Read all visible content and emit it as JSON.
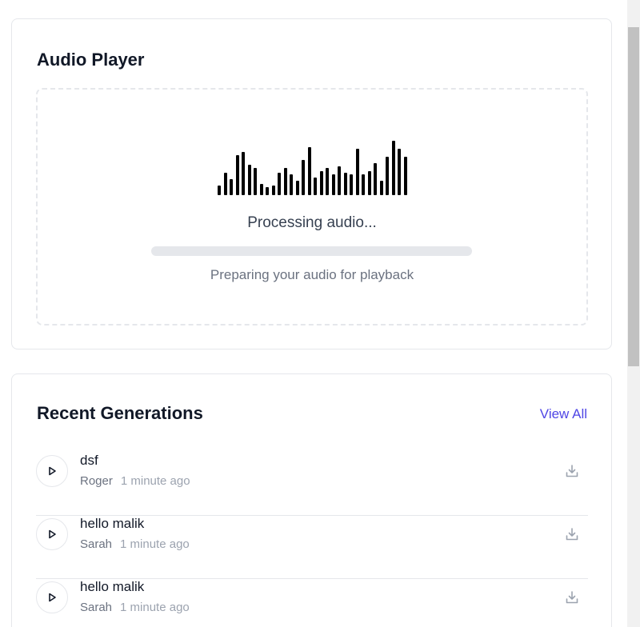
{
  "player": {
    "title": "Audio Player",
    "processing_label": "Processing audio...",
    "preparing_label": "Preparing your audio for playback",
    "progress_fraction": 0.0
  },
  "recent": {
    "title": "Recent Generations",
    "view_all_label": "View All",
    "items": [
      {
        "title": "dsf",
        "voice": "Roger",
        "time": "1 minute ago"
      },
      {
        "title": "hello malik",
        "voice": "Sarah",
        "time": "1 minute ago"
      },
      {
        "title": "hello malik",
        "voice": "Sarah",
        "time": "1 minute ago"
      }
    ]
  },
  "icons": {
    "play": "play-icon",
    "download": "download-icon"
  },
  "colors": {
    "accent": "#4f46e5",
    "waveform": "#000000",
    "border": "#e5e7eb"
  }
}
